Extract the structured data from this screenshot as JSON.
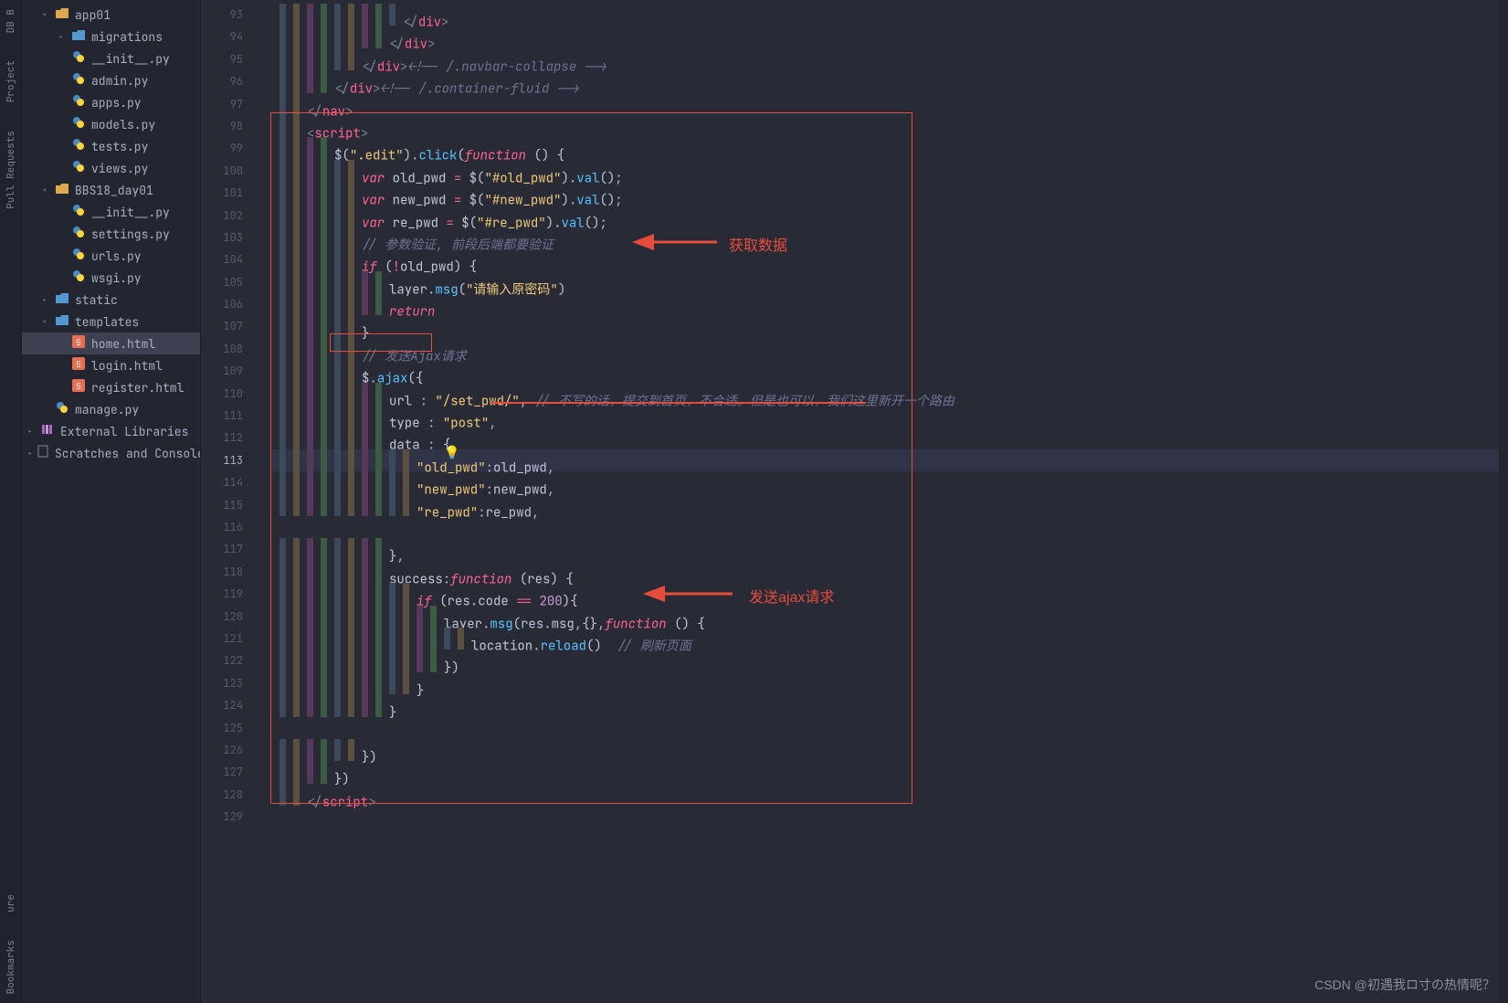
{
  "leftRail": {
    "top": [
      "DB B",
      "Project",
      "Pull Requests"
    ],
    "bottom": [
      "ure",
      "Bookmarks"
    ]
  },
  "tree": [
    {
      "depth": 1,
      "arrow": "▾",
      "icon": "folder-py",
      "label": "app01",
      "cls": "i-folder-py"
    },
    {
      "depth": 2,
      "arrow": "▸",
      "icon": "folder",
      "label": "migrations",
      "cls": "i-folder-blue"
    },
    {
      "depth": 2,
      "arrow": "",
      "icon": "py",
      "label": "__init__.py",
      "cls": "i-py"
    },
    {
      "depth": 2,
      "arrow": "",
      "icon": "py",
      "label": "admin.py",
      "cls": "i-py"
    },
    {
      "depth": 2,
      "arrow": "",
      "icon": "py",
      "label": "apps.py",
      "cls": "i-py"
    },
    {
      "depth": 2,
      "arrow": "",
      "icon": "py",
      "label": "models.py",
      "cls": "i-py"
    },
    {
      "depth": 2,
      "arrow": "",
      "icon": "py",
      "label": "tests.py",
      "cls": "i-py"
    },
    {
      "depth": 2,
      "arrow": "",
      "icon": "py",
      "label": "views.py",
      "cls": "i-py"
    },
    {
      "depth": 1,
      "arrow": "▾",
      "icon": "folder-py",
      "label": "BBS18_day01",
      "cls": "i-folder-py"
    },
    {
      "depth": 2,
      "arrow": "",
      "icon": "py",
      "label": "__init__.py",
      "cls": "i-py"
    },
    {
      "depth": 2,
      "arrow": "",
      "icon": "py",
      "label": "settings.py",
      "cls": "i-py"
    },
    {
      "depth": 2,
      "arrow": "",
      "icon": "py",
      "label": "urls.py",
      "cls": "i-py"
    },
    {
      "depth": 2,
      "arrow": "",
      "icon": "py",
      "label": "wsgi.py",
      "cls": "i-py"
    },
    {
      "depth": 1,
      "arrow": "▸",
      "icon": "folder",
      "label": "static",
      "cls": "i-folder-blue"
    },
    {
      "depth": 1,
      "arrow": "▾",
      "icon": "folder",
      "label": "templates",
      "cls": "i-folder-blue"
    },
    {
      "depth": 2,
      "arrow": "",
      "icon": "html",
      "label": "home.html",
      "cls": "i-html",
      "selected": true
    },
    {
      "depth": 2,
      "arrow": "",
      "icon": "html",
      "label": "login.html",
      "cls": "i-html"
    },
    {
      "depth": 2,
      "arrow": "",
      "icon": "html",
      "label": "register.html",
      "cls": "i-html"
    },
    {
      "depth": 1,
      "arrow": "",
      "icon": "py",
      "label": "manage.py",
      "cls": "i-py"
    },
    {
      "depth": 0,
      "arrow": "▸",
      "icon": "lib",
      "label": "External Libraries",
      "cls": "i-lib"
    },
    {
      "depth": 0,
      "arrow": "▸",
      "icon": "scratch",
      "label": "Scratches and Consoles",
      "cls": "i-scratch"
    }
  ],
  "firstLine": 93,
  "currentLine": 113,
  "annotations": {
    "label1": "获取数据",
    "label2": "发送ajax请求"
  },
  "watermark": "CSDN @初遇我ロ寸の热情呢？",
  "code": [
    {
      "ind": 9,
      "html": "<span class='c-angle'>&lt;/</span><span class='c-tag'>div</span><span class='c-angle'>&gt;</span>"
    },
    {
      "ind": 8,
      "html": "<span class='c-angle'>&lt;/</span><span class='c-tag'>div</span><span class='c-angle'>&gt;</span>"
    },
    {
      "ind": 6,
      "html": "<span class='c-angle'>&lt;/</span><span class='c-tag'>div</span><span class='c-angle'>&gt;</span><span class='c-comment'>&lt;!-- /.navbar-collapse --&gt;</span>"
    },
    {
      "ind": 4,
      "html": "<span class='c-angle'>&lt;/</span><span class='c-tag'>div</span><span class='c-angle'>&gt;</span><span class='c-comment'>&lt;!-- /.container-fluid --&gt;</span>"
    },
    {
      "ind": 2,
      "html": "<span class='c-angle'>&lt;/</span><span class='c-tag'>nav</span><span class='c-angle'>&gt;</span>"
    },
    {
      "ind": 2,
      "html": "<span class='c-angle'>&lt;</span><span class='c-tag'>script</span><span class='c-angle'>&gt;</span>"
    },
    {
      "ind": 4,
      "html": "<span class='c-ident'>$</span><span class='c-bracket'>(</span><span class='c-str'>\".edit\"</span><span class='c-bracket'>)</span><span class='c-text'>.</span><span class='c-fn'>click</span><span class='c-bracket'>(</span><span class='c-keyword'>function</span> <span class='c-bracket'>()</span> <span class='c-bracket'>{</span>"
    },
    {
      "ind": 6,
      "html": "<span class='c-keyword'>var</span> <span class='c-ident'>old_pwd</span> <span class='c-op'>=</span> <span class='c-ident'>$</span><span class='c-bracket'>(</span><span class='c-str'>\"#old_pwd\"</span><span class='c-bracket'>)</span><span class='c-text'>.</span><span class='c-fn'>val</span><span class='c-bracket'>()</span><span class='c-text'>;</span>"
    },
    {
      "ind": 6,
      "html": "<span class='c-keyword'>var</span> <span class='c-ident'>new_pwd</span> <span class='c-op'>=</span> <span class='c-ident'>$</span><span class='c-bracket'>(</span><span class='c-str'>\"#new_pwd\"</span><span class='c-bracket'>)</span><span class='c-text'>.</span><span class='c-fn'>val</span><span class='c-bracket'>()</span><span class='c-text'>;</span>"
    },
    {
      "ind": 6,
      "html": "<span class='c-keyword'>var</span> <span class='c-ident'>re_pwd</span> <span class='c-op'>=</span> <span class='c-ident'>$</span><span class='c-bracket'>(</span><span class='c-str'>\"#re_pwd\"</span><span class='c-bracket'>)</span><span class='c-text'>.</span><span class='c-fn'>val</span><span class='c-bracket'>()</span><span class='c-text'>;</span>"
    },
    {
      "ind": 6,
      "html": "<span class='c-comment'>// 参数验证, 前段后端都要验证</span>"
    },
    {
      "ind": 6,
      "html": "<span class='c-keyword'>if</span> <span class='c-bracket'>(</span><span class='c-op'>!</span><span class='c-ident'>old_pwd</span><span class='c-bracket'>)</span> <span class='c-bracket'>{</span>"
    },
    {
      "ind": 8,
      "html": "<span class='c-ident'>layer</span><span class='c-text'>.</span><span class='c-fn'>msg</span><span class='c-bracket'>(</span><span class='c-str'>\"请输入原密码\"</span><span class='c-bracket'>)</span>"
    },
    {
      "ind": 8,
      "html": "<span class='c-keyword'>return</span>"
    },
    {
      "ind": 6,
      "html": "<span class='c-bracket'>}</span>"
    },
    {
      "ind": 6,
      "html": "<span class='c-comment'>// 发送Ajax请求</span>"
    },
    {
      "ind": 6,
      "html": "<span class='c-ident'>$</span><span class='c-text'>.</span><span class='c-fn'>ajax</span><span class='c-bracket'>({</span>"
    },
    {
      "ind": 8,
      "html": "<span class='c-ident'>url</span> <span class='c-text'>:</span> <span class='c-str'>\"/set_pwd/\"</span><span class='c-text'>,</span> <span class='c-comment'>// 不写的话，提交到首页，不合适。但是也可以，我们这里新开一个路由</span>"
    },
    {
      "ind": 8,
      "html": "<span class='c-ident'>type</span> <span class='c-text'>:</span> <span class='c-str'>\"post\"</span><span class='c-text'>,</span>"
    },
    {
      "ind": 8,
      "html": "<span class='c-ident'>data</span> <span class='c-text'>:</span> <span class='c-bracket'>{</span>"
    },
    {
      "ind": 10,
      "html": "<span class='c-str'>\"old_pwd\"</span><span class='c-text'>:</span><span class='c-ident'>old_pwd</span><span class='c-text'>,</span>"
    },
    {
      "ind": 10,
      "html": "<span class='c-str'>\"new_pwd\"</span><span class='c-text'>:</span><span class='c-ident'>new_pwd</span><span class='c-text'>,</span>"
    },
    {
      "ind": 10,
      "html": "<span class='c-str'>\"re_pwd\"</span><span class='c-text'>:</span><span class='c-ident'>re_pwd</span><span class='c-text'>,</span>"
    },
    {
      "ind": 0,
      "html": ""
    },
    {
      "ind": 8,
      "html": "<span class='c-bracket'>}</span><span class='c-text'>,</span>"
    },
    {
      "ind": 8,
      "html": "<span class='c-ident'>success</span><span class='c-text'>:</span><span class='c-keyword'>function</span> <span class='c-bracket'>(</span><span class='c-ident'>res</span><span class='c-bracket'>)</span> <span class='c-bracket'>{</span>"
    },
    {
      "ind": 10,
      "html": "<span class='c-keyword'>if</span> <span class='c-bracket'>(</span><span class='c-ident'>res</span><span class='c-text'>.</span><span class='c-ident'>code</span> <span class='c-op'>==</span> <span class='c-num'>200</span><span class='c-bracket'>){</span>"
    },
    {
      "ind": 12,
      "html": "<span class='c-ident'>layer</span><span class='c-text'>.</span><span class='c-fn'>msg</span><span class='c-bracket'>(</span><span class='c-ident'>res</span><span class='c-text'>.</span><span class='c-ident'>msg</span><span class='c-text'>,</span><span class='c-bracket'>{}</span><span class='c-text'>,</span><span class='c-keyword'>function</span> <span class='c-bracket'>()</span> <span class='c-bracket'>{</span>"
    },
    {
      "ind": 14,
      "html": "<span class='c-ident'>location</span><span class='c-text'>.</span><span class='c-fn'>reload</span><span class='c-bracket'>()</span>  <span class='c-comment'>// 刷新页面</span>"
    },
    {
      "ind": 12,
      "html": "<span class='c-bracket'>})</span>"
    },
    {
      "ind": 10,
      "html": "<span class='c-bracket'>}</span>"
    },
    {
      "ind": 8,
      "html": "<span class='c-bracket'>}</span>"
    },
    {
      "ind": 0,
      "html": ""
    },
    {
      "ind": 6,
      "html": "<span class='c-bracket'>})</span>"
    },
    {
      "ind": 4,
      "html": "<span class='c-bracket'>})</span>"
    },
    {
      "ind": 2,
      "html": "<span class='c-angle'>&lt;/</span><span class='c-tag'>script</span><span class='c-angle'>&gt;</span>"
    },
    {
      "ind": 0,
      "html": ""
    }
  ],
  "indentColors": [
    "#3a4a5a",
    "#5c5140",
    "#56395a",
    "#3d5a43",
    "#3a4a5a",
    "#5c5140",
    "#56395a",
    "#3d5a43",
    "#3a4a5a",
    "#5c5140",
    "#56395a",
    "#3d5a43",
    "#3a4a5a",
    "#5c5140"
  ]
}
